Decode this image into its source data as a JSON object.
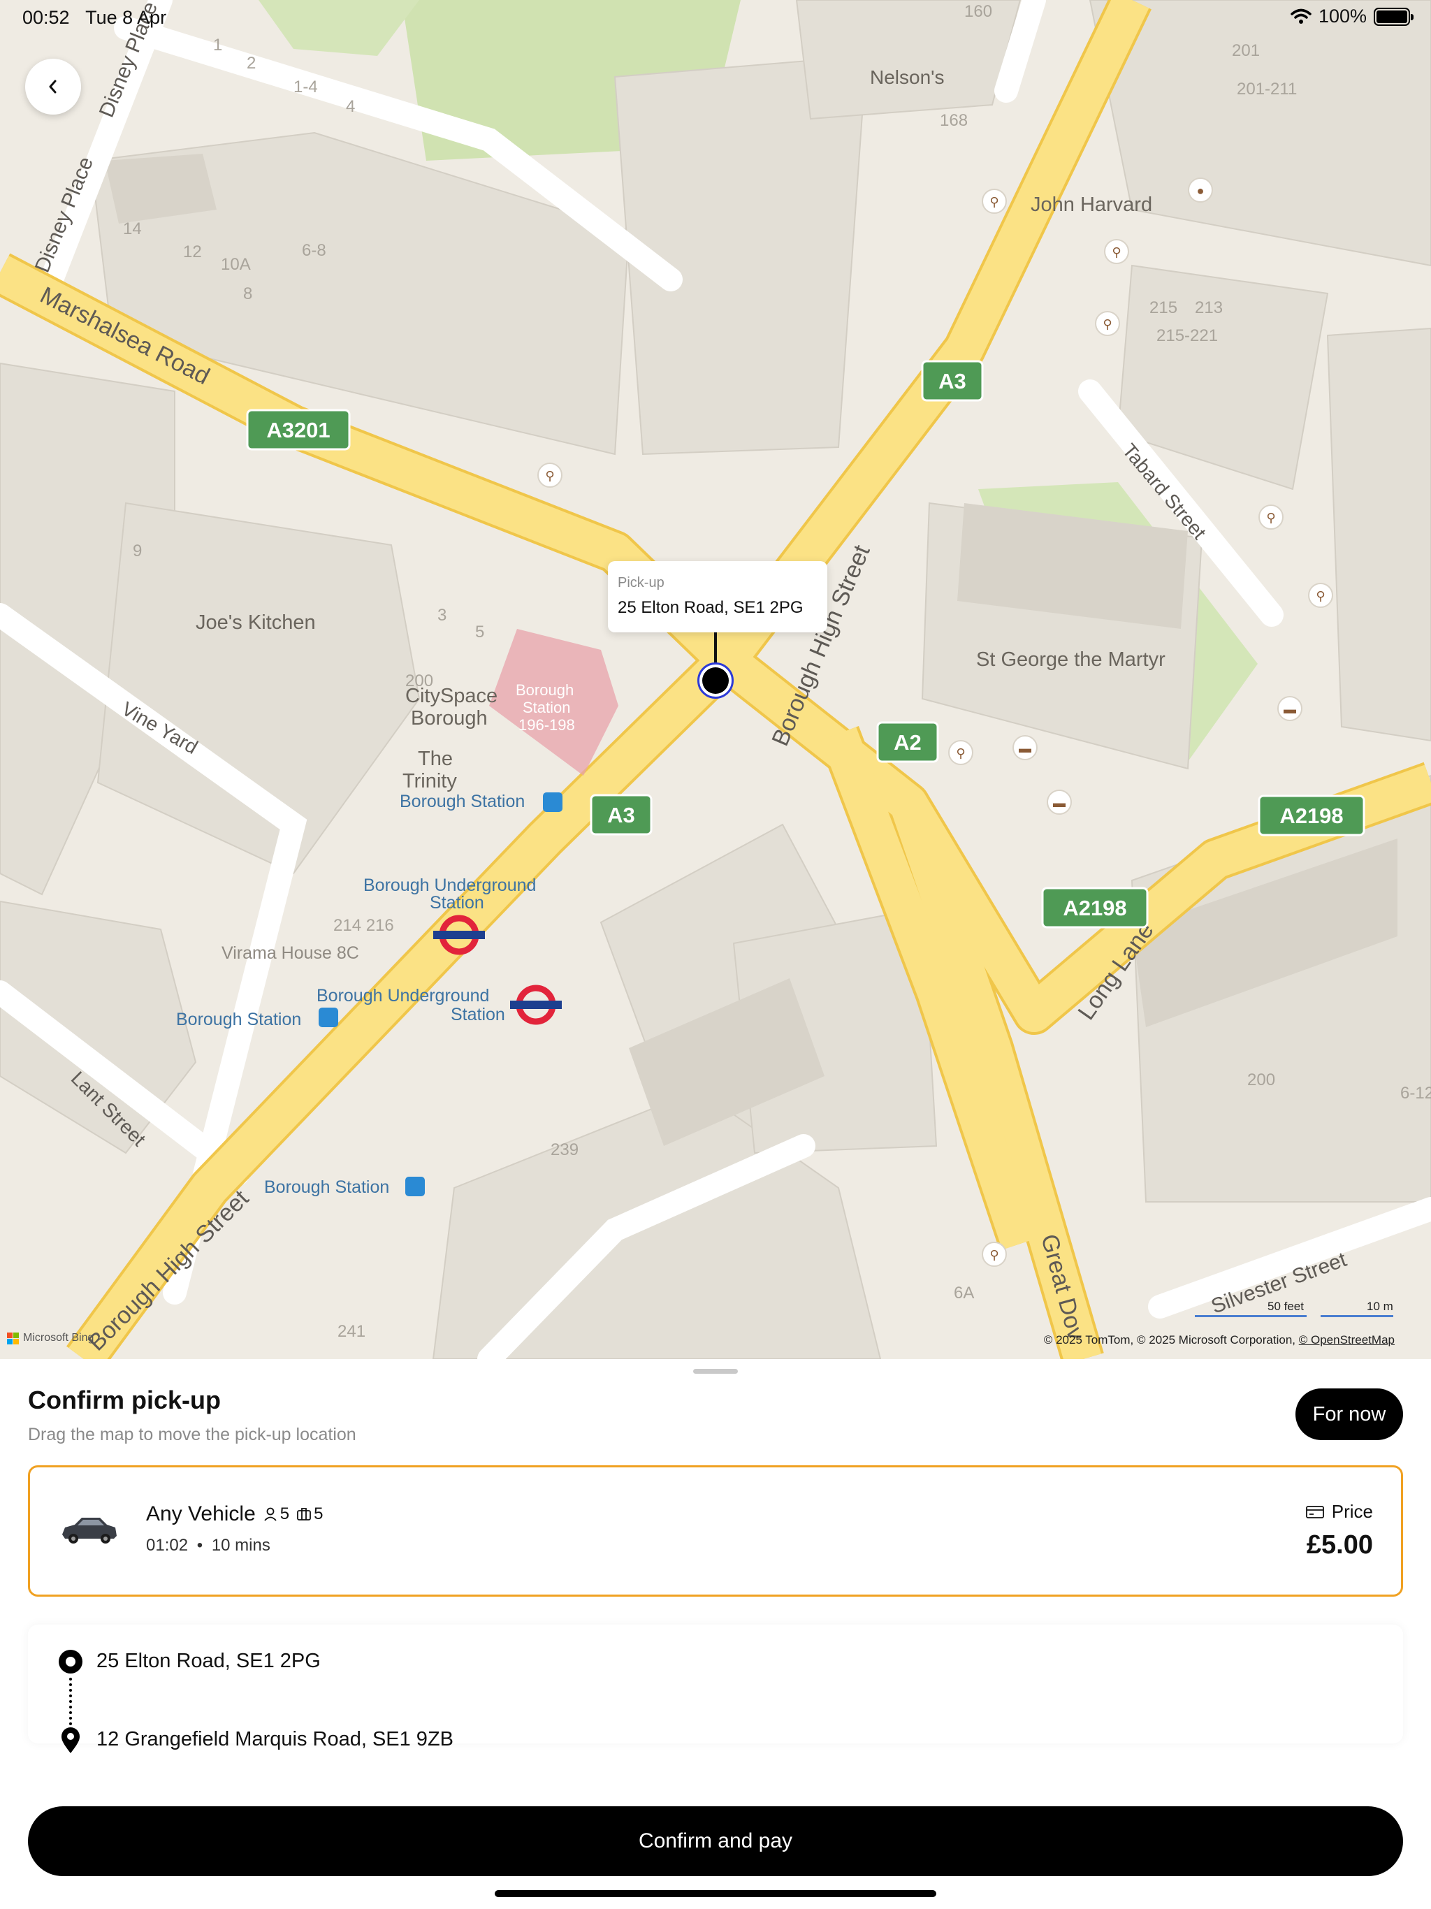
{
  "status_bar": {
    "time": "00:52",
    "date": "Tue 8 Apr",
    "battery_percent": "100%",
    "battery_level": 1.0
  },
  "map": {
    "pickup_caption": "Pick-up",
    "pickup_address": "25 Elton Road, SE1 2PG",
    "labels": {
      "marshalsea_road": "Marshalsea Road",
      "disney_place_1": "Disney Place",
      "disney_place_2": "Disney Place",
      "nelsons": "Nelson's",
      "john_harvard": "John Harvard",
      "tabard_street": "Tabard Street",
      "joes_kitchen": "Joe's Kitchen",
      "citysapce_1": "CitySpace",
      "citysapce_2": "Borough",
      "the_trinity_1": "The",
      "the_trinity_2": "Trinity",
      "borough_station": "Borough Station",
      "borough_station_pink_1": "Borough",
      "borough_station_pink_2": "Station",
      "borough_station_pink_3": "196-198",
      "vine_yard": "Vine Yard",
      "borough_high_street_1": "Borough High Street",
      "borough_high_street_2": "Borough High Street",
      "st_george": "St George the Martyr",
      "borough_underground_1a": "Borough Underground",
      "borough_underground_1b": "Station",
      "borough_underground_2a": "Borough Underground",
      "borough_underground_2b": "Station",
      "borough_station_2": "Borough Station",
      "borough_station_3": "Borough Station",
      "virama_house": "Virama House 8C",
      "lant_street": "Lant Street",
      "long_lane": "Long Lane",
      "great_dover": "Great Dov",
      "silvester_street": "Silvester Street",
      "n_160": "160",
      "n_168": "168",
      "n_201": "201",
      "n_201_211": "201-211",
      "n_215": "215",
      "n_213": "213",
      "n_215_221": "215-221",
      "n_1": "1",
      "n_2": "2",
      "n_1_4": "1-4",
      "n_4": "4",
      "n_14": "14",
      "n_12": "12",
      "n_10a": "10A",
      "n_8": "8",
      "n_6_8": "6-8",
      "n_9": "9",
      "n_3": "3",
      "n_5": "5",
      "n_200": "200",
      "n_214_216": "214 216",
      "n_239": "239",
      "n_241": "241",
      "n_6a": "6A",
      "n_200b": "200",
      "n_6_12": "6-12"
    },
    "road_shields": {
      "a3201": "A3201",
      "a3_top": "A3",
      "a3_mid": "A3",
      "a2": "A2",
      "a2198_right": "A2198",
      "a2198_mid": "A2198"
    },
    "scale": {
      "feet": "50 feet",
      "meters": "10 m"
    },
    "attribution": {
      "prefix": "© 2025 TomTom, © 2025 Microsoft Corporation, ",
      "osm": "© OpenStreetMap"
    },
    "bing": "Microsoft Bing",
    "colors": {
      "road": "#fbe186",
      "road_edge": "#f2c94c",
      "building": "#e4e0d7",
      "park": "#cfe1b0",
      "shield": "#4f9a55"
    }
  },
  "sheet": {
    "title": "Confirm pick-up",
    "subtitle": "Drag the map to move the pick-up location",
    "for_now": "For now",
    "vehicle": {
      "name": "Any Vehicle",
      "passengers": "5",
      "luggage": "5",
      "time": "01:02",
      "separator": "•",
      "eta": "10 mins",
      "price_label": "Price",
      "price": "£5.00",
      "accent": "#f0a122"
    },
    "route": {
      "origin": "25 Elton Road, SE1 2PG",
      "destination": "12 Grangefield Marquis Road, SE1 9ZB"
    },
    "confirm": "Confirm and pay"
  }
}
